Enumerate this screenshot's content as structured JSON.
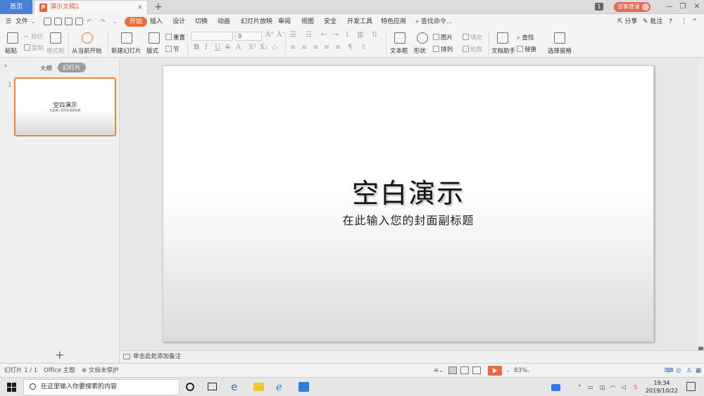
{
  "tabs": {
    "home": "首页",
    "document": "演示文稿1",
    "close": "×",
    "add": "+"
  },
  "titlebar": {
    "badge": "1",
    "visitor_login": "访客登录",
    "minimize": "—",
    "restore": "❐",
    "close": "✕"
  },
  "menu": {
    "file": "文件",
    "items": [
      "开始",
      "插入",
      "设计",
      "切换",
      "动画",
      "幻灯片放映",
      "审阅",
      "视图",
      "安全",
      "开发工具",
      "特色应用"
    ],
    "active_index": 0,
    "search": "查找命令...",
    "share": "分享",
    "comment": "批注"
  },
  "ribbon": {
    "paste": "粘贴",
    "cut": "剪切",
    "copy": "复制",
    "format_painter": "格式刷",
    "from_start": "从当前开始",
    "new_slide": "新建幻灯片",
    "layout": "版式",
    "reset": "重置",
    "section": "节",
    "font_size": "0",
    "textbox": "文本框",
    "shape": "形状",
    "picture": "图片",
    "fill": "填充",
    "arrange": "排列",
    "outline": "轮廓",
    "doc_assistant": "文档助手",
    "find": "查找",
    "replace": "替换",
    "select_pane": "选择窗格"
  },
  "left_panel": {
    "collapse": "«",
    "tab_outline": "大纲",
    "tab_slides": "幻灯片",
    "slide_number": "1",
    "thumb_title": "空白演示",
    "thumb_subtitle": "在此输入您的封面副标题",
    "add": "+"
  },
  "slide": {
    "title": "空白演示",
    "subtitle": "在此输入您的封面副标题"
  },
  "notes": {
    "placeholder": "单击此处添加备注"
  },
  "status": {
    "slide_counter": "幻灯片 1 / 1",
    "theme": "Office 主题",
    "protection": "文档未保护",
    "zoom": "83%"
  },
  "taskbar": {
    "search_placeholder": "在这里输入你要搜索的内容",
    "time": "19:34",
    "date": "2019/10/22"
  },
  "colors": {
    "accent": "#e9703a",
    "home_tab": "#4a7fd9"
  }
}
